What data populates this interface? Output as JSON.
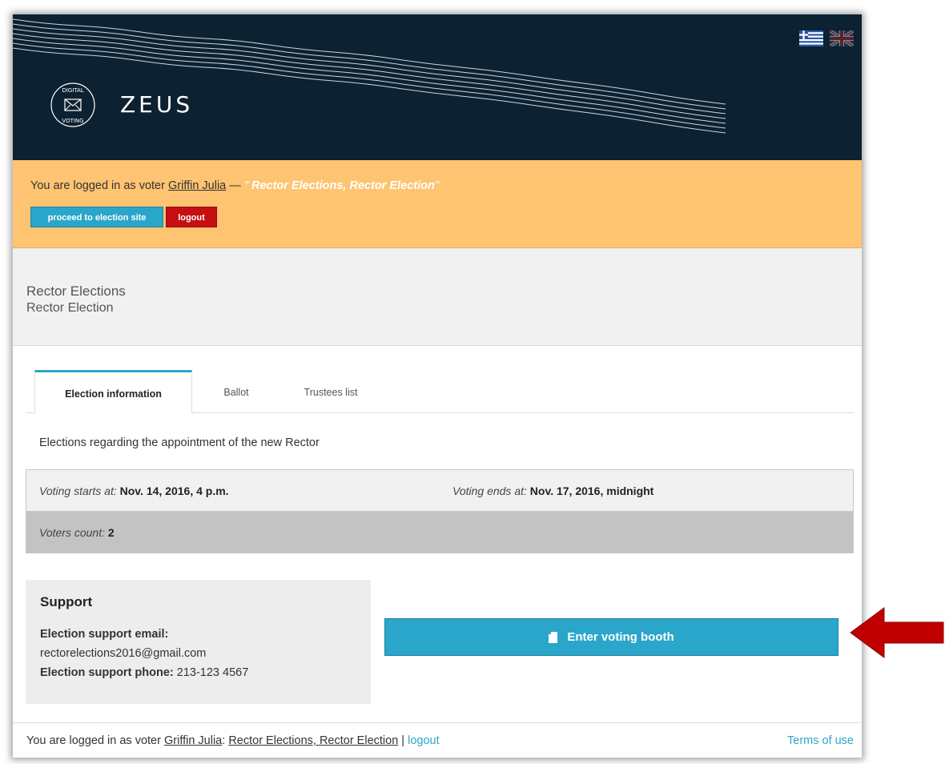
{
  "header": {
    "brand": "ZEUS",
    "logo_text_top": "DIGITAL",
    "logo_text_bottom": "VOTING",
    "flags": [
      "greek-flag-icon",
      "uk-flag-icon"
    ]
  },
  "loginbar": {
    "prefix": "You are logged in as voter ",
    "voter_name": "Griffin Julia",
    "dash": " — ",
    "quote_open": "\"",
    "election": " Rector Elections, Rector Election",
    "quote_close": "\"",
    "proceed_label": "proceed to election site",
    "logout_label": "logout"
  },
  "election": {
    "title": "Rector Elections",
    "subtitle": "Rector Election"
  },
  "tabs": [
    {
      "label": "Election information",
      "active": true
    },
    {
      "label": "Ballot",
      "active": false
    },
    {
      "label": "Trustees list",
      "active": false
    }
  ],
  "description": "Elections regarding the appointment of the new Rector",
  "info": {
    "start_label": "Voting starts at:",
    "start_value": "Nov. 14, 2016, 4 p.m.",
    "end_label": "Voting ends at:",
    "end_value": "Nov. 17, 2016, midnight",
    "voters_label": "Voters count:",
    "voters_value": "2"
  },
  "support": {
    "heading": "Support",
    "email_label": "Election support email:",
    "email_value": "rectorelections2016@gmail.com",
    "phone_label": "Election support phone:",
    "phone_value": "213-123 4567"
  },
  "booth_button": {
    "label": "Enter voting booth",
    "icon": "document-icon"
  },
  "footer": {
    "prefix": "You are logged in as voter ",
    "voter_name": "Griffin Julia",
    "colon": ": ",
    "election": "Rector Elections, Rector Election",
    "separator": " | ",
    "logout_label": "logout",
    "terms_label": "Terms of use"
  },
  "colors": {
    "header_bg": "#0c2131",
    "login_bar_bg": "#fec471",
    "accent_blue": "#2ba6cb",
    "logout_red": "#c60f13",
    "arrow_red": "#c00000"
  }
}
